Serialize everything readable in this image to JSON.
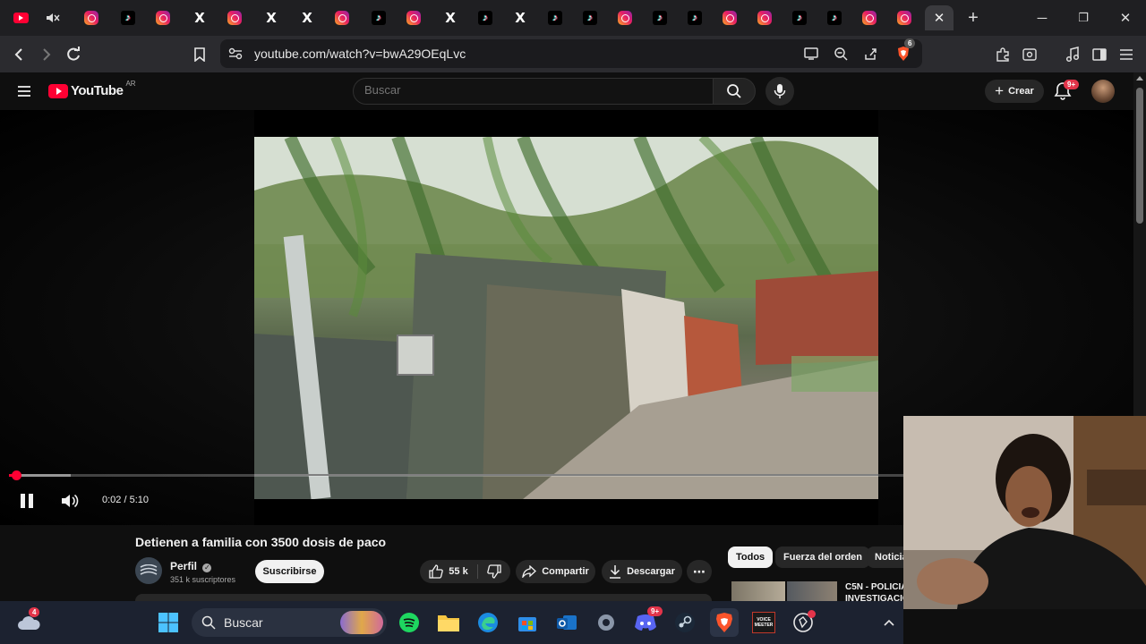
{
  "tabs": [
    {
      "icon": "youtube-icon"
    },
    {
      "icon": "mute-icon"
    },
    {
      "icon": "instagram-icon"
    },
    {
      "icon": "tiktok-icon"
    },
    {
      "icon": "instagram-icon"
    },
    {
      "icon": "x-icon"
    },
    {
      "icon": "instagram-icon"
    },
    {
      "icon": "x-icon"
    },
    {
      "icon": "x-icon"
    },
    {
      "icon": "instagram-icon"
    },
    {
      "icon": "tiktok-icon"
    },
    {
      "icon": "instagram-icon"
    },
    {
      "icon": "x-icon"
    },
    {
      "icon": "tiktok-icon"
    },
    {
      "icon": "x-icon"
    },
    {
      "icon": "tiktok-icon"
    },
    {
      "icon": "tiktok-icon"
    },
    {
      "icon": "instagram-icon"
    },
    {
      "icon": "tiktok-icon"
    },
    {
      "icon": "tiktok-icon"
    },
    {
      "icon": "instagram-icon"
    },
    {
      "icon": "instagram-icon"
    },
    {
      "icon": "tiktok-icon"
    },
    {
      "icon": "tiktok-icon"
    },
    {
      "icon": "instagram-icon"
    },
    {
      "icon": "instagram-icon"
    }
  ],
  "browser": {
    "url": "youtube.com/watch?v=bwA29OEqLvc",
    "shields_count": "6",
    "accent": "#fb542b"
  },
  "youtube": {
    "logo_text": "YouTube",
    "region": "AR",
    "search_placeholder": "Buscar",
    "create_label": "Crear",
    "notifications_badge": "9+"
  },
  "player": {
    "time": "0:02 / 5:10",
    "progress_fraction": 0.00645,
    "buffered_fraction": 0.055,
    "progress_color": "#ff0033"
  },
  "video": {
    "title": "Detienen a familia con 3500 dosis de paco",
    "channel": "Perfil",
    "subscribers": "351 k suscriptores",
    "subscribe_label": "Suscribirse",
    "likes": "55 k",
    "share_label": "Compartir",
    "download_label": "Descargar"
  },
  "chips": [
    "Todos",
    "Fuerza del orden",
    "Noticias"
  ],
  "recommendation": {
    "title_line1": "C5N - POLICIA",
    "title_line2": "INVESTIGACIÓN"
  },
  "taskbar": {
    "search_label": "Buscar",
    "weather_badge": "4",
    "discord_badge": "9+",
    "voicemeeter_label": "VOICE MEETER"
  }
}
